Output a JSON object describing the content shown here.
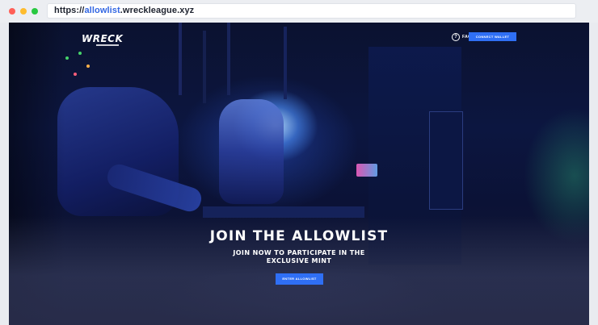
{
  "browser": {
    "url_prefix": "https://",
    "url_highlight": "allowlist",
    "url_suffix": ".wreckleague.xyz"
  },
  "nav": {
    "logo_text": "WRECK",
    "faq_icon_glyph": "?",
    "faq_label": "FAQ",
    "connect_label": "CONNECT WALLET"
  },
  "hero": {
    "title": "JOIN THE ALLOWLIST",
    "subtitle_line1": "JOIN NOW TO PARTICIPATE IN THE",
    "subtitle_line2": "EXCLUSIVE MINT",
    "cta_label": "ENTER ALLOWLIST"
  },
  "colors": {
    "accent": "#2f6ff5",
    "url_highlight": "#3367e3",
    "background_dark": "#0b1230"
  },
  "icons": {
    "window_controls": [
      "close-dot-icon",
      "minimize-dot-icon",
      "maximize-dot-icon"
    ],
    "faq": "help-circle-icon"
  }
}
